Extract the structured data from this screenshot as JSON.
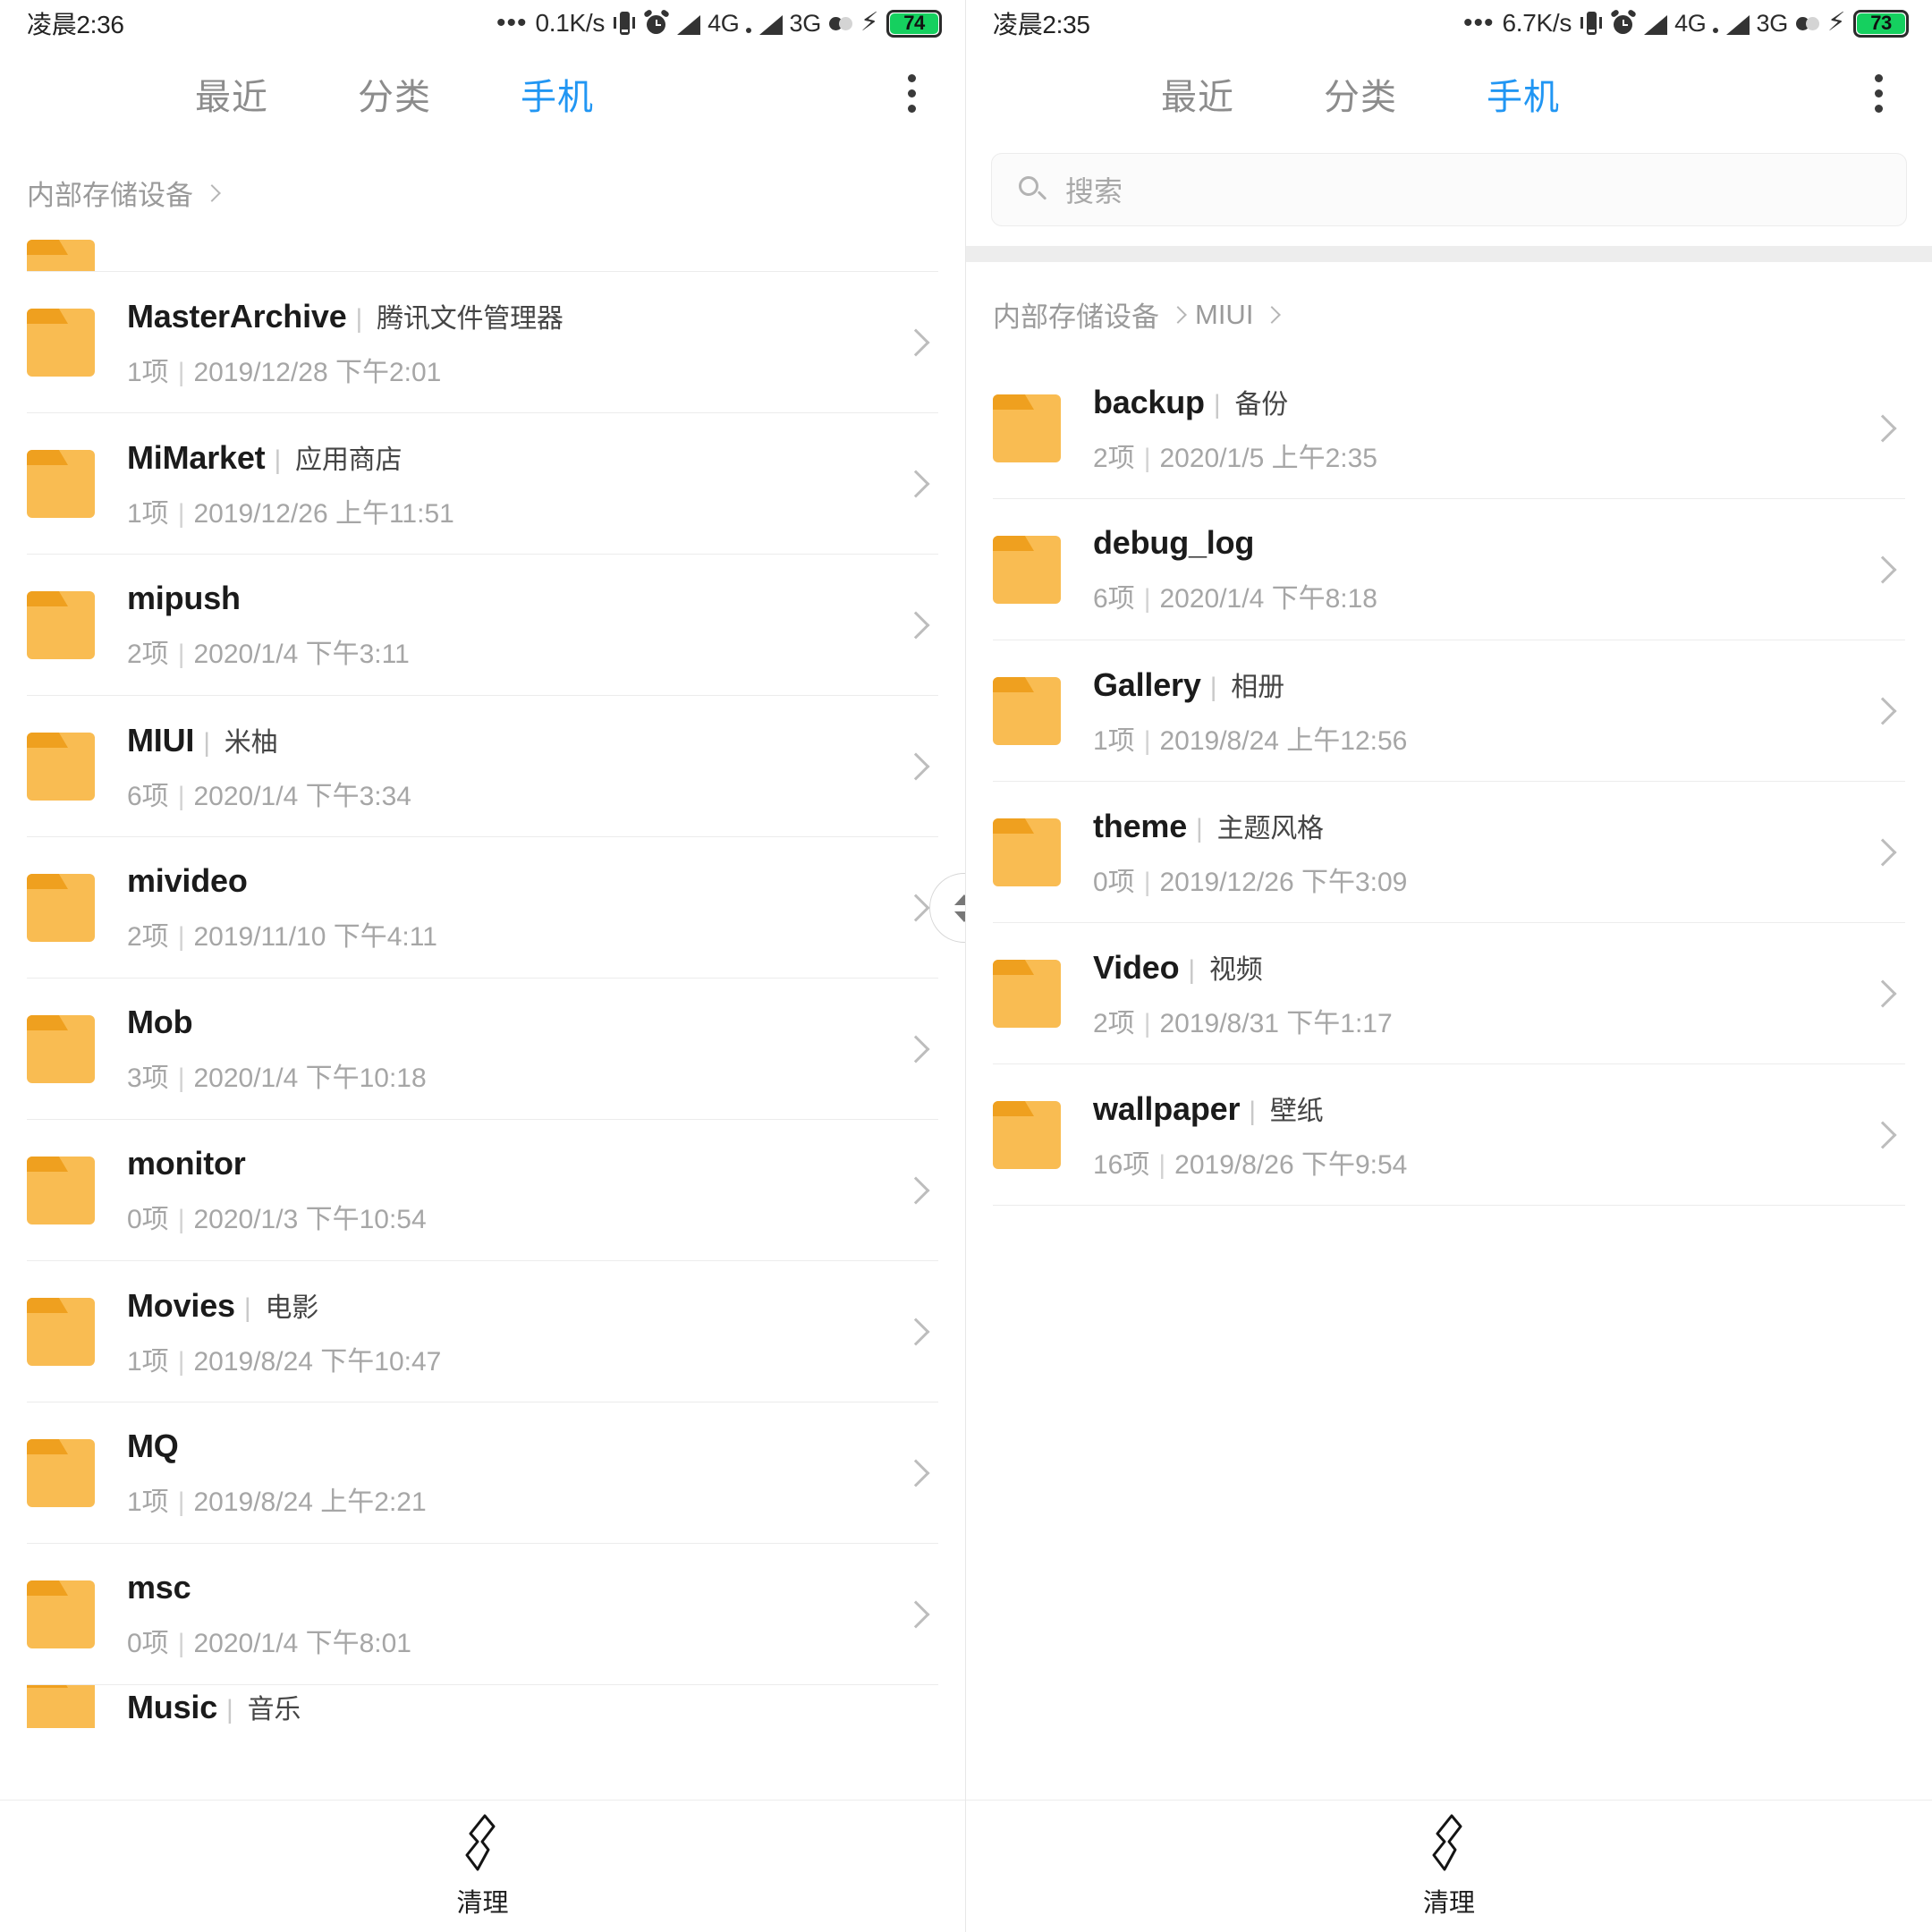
{
  "left": {
    "status": {
      "time": "凌晨2:36",
      "dots": "•••",
      "speed": "0.1K/s",
      "net1": "4G",
      "net2": "3G",
      "battery": "74"
    },
    "tabs": [
      {
        "label": "最近",
        "active": false
      },
      {
        "label": "分类",
        "active": false
      },
      {
        "label": "手机",
        "active": true
      }
    ],
    "menu_icon": "overflow-menu-icon",
    "breadcrumb": [
      {
        "label": "内部存储设备"
      }
    ],
    "rows": [
      {
        "name": "MasterArchive",
        "alias": "腾讯文件管理器",
        "count": "1项",
        "date": "2019/12/28 下午2:01"
      },
      {
        "name": "MiMarket",
        "alias": "应用商店",
        "count": "1项",
        "date": "2019/12/26 上午11:51"
      },
      {
        "name": "mipush",
        "alias": "",
        "count": "2项",
        "date": "2020/1/4 下午3:11"
      },
      {
        "name": "MIUI",
        "alias": "米柚",
        "count": "6项",
        "date": "2020/1/4 下午3:34"
      },
      {
        "name": "mivideo",
        "alias": "",
        "count": "2项",
        "date": "2019/11/10 下午4:11"
      },
      {
        "name": "Mob",
        "alias": "",
        "count": "3项",
        "date": "2020/1/4 下午10:18"
      },
      {
        "name": "monitor",
        "alias": "",
        "count": "0项",
        "date": "2020/1/3 下午10:54"
      },
      {
        "name": "Movies",
        "alias": "电影",
        "count": "1项",
        "date": "2019/8/24 下午10:47"
      },
      {
        "name": "MQ",
        "alias": "",
        "count": "1项",
        "date": "2019/8/24 上午2:21"
      },
      {
        "name": "msc",
        "alias": "",
        "count": "0项",
        "date": "2020/1/4 下午8:01"
      }
    ],
    "clipped_bottom_row": {
      "name": "Music",
      "alias": "音乐"
    },
    "bottom": {
      "label": "清理",
      "icon": "broom-clean-icon"
    }
  },
  "right": {
    "status": {
      "time": "凌晨2:35",
      "dots": "•••",
      "speed": "6.7K/s",
      "net1": "4G",
      "net2": "3G",
      "battery": "73"
    },
    "tabs": [
      {
        "label": "最近",
        "active": false
      },
      {
        "label": "分类",
        "active": false
      },
      {
        "label": "手机",
        "active": true
      }
    ],
    "menu_icon": "overflow-menu-icon",
    "search": {
      "placeholder": "搜索",
      "icon": "search-icon"
    },
    "breadcrumb": [
      {
        "label": "内部存储设备"
      },
      {
        "label": "MIUI"
      }
    ],
    "rows": [
      {
        "name": "backup",
        "alias": "备份",
        "count": "2项",
        "date": "2020/1/5 上午2:35"
      },
      {
        "name": "debug_log",
        "alias": "",
        "count": "6项",
        "date": "2020/1/4 下午8:18"
      },
      {
        "name": "Gallery",
        "alias": "相册",
        "count": "1项",
        "date": "2019/8/24 上午12:56"
      },
      {
        "name": "theme",
        "alias": "主题风格",
        "count": "0项",
        "date": "2019/12/26 下午3:09"
      },
      {
        "name": "Video",
        "alias": "视频",
        "count": "2项",
        "date": "2019/8/31 下午1:17"
      },
      {
        "name": "wallpaper",
        "alias": "壁纸",
        "count": "16项",
        "date": "2019/8/26 下午9:54"
      }
    ],
    "bottom": {
      "label": "清理",
      "icon": "broom-clean-icon"
    }
  },
  "colors": {
    "accent": "#2196f3",
    "folder": "#f9bc52",
    "folder_tab": "#efa01f",
    "battery_green": "#15d05f"
  }
}
